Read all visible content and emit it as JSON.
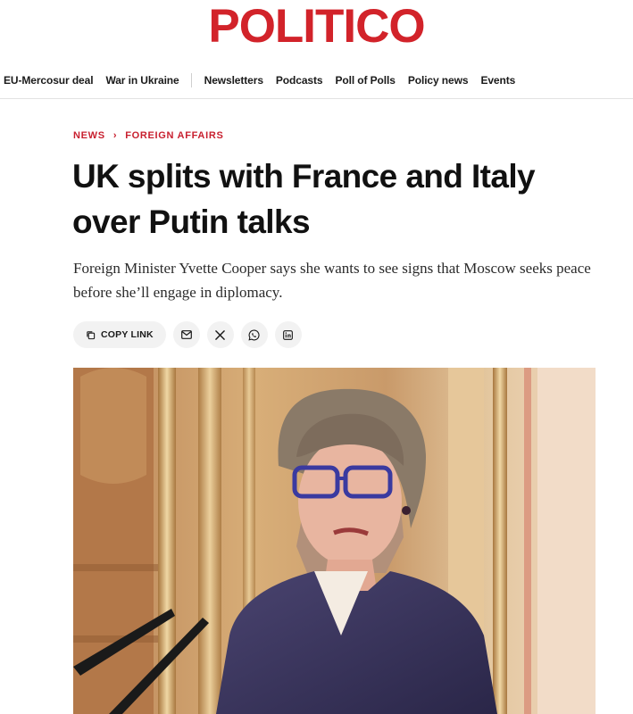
{
  "brand": {
    "name": "POLITICO",
    "color": "#d2232a"
  },
  "nav": {
    "group_one": [
      "EU-Mercosur deal",
      "War in Ukraine"
    ],
    "group_two": [
      "Newsletters",
      "Podcasts",
      "Poll of Polls",
      "Policy news",
      "Events"
    ]
  },
  "breadcrumb": {
    "section": "NEWS",
    "separator": "›",
    "subsection": "FOREIGN AFFAIRS",
    "color": "#c8202f"
  },
  "article": {
    "headline": "UK splits with France and Italy over Putin talks",
    "dek": "Foreign Minister Yvette Cooper says she wants to see signs that Moscow seeks peace before she’ll engage in diplomacy."
  },
  "share": {
    "copy_label": "COPY LINK",
    "icons": [
      "copy-icon",
      "email-icon",
      "x-icon",
      "whatsapp-icon",
      "linkedin-icon"
    ]
  }
}
